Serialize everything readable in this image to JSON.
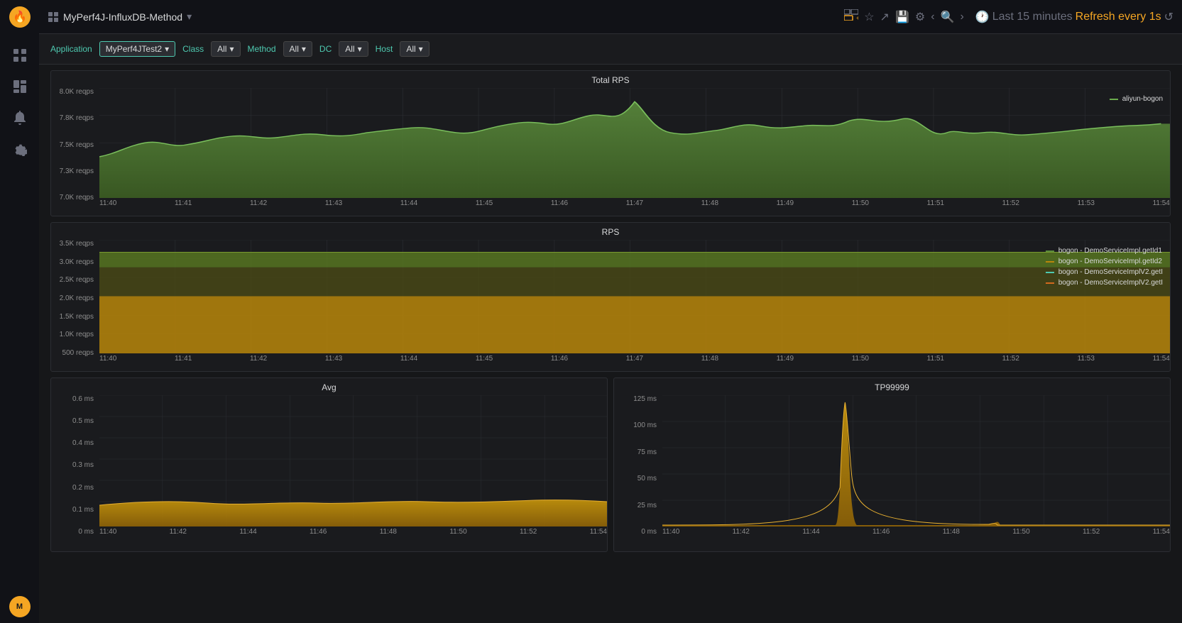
{
  "app": {
    "title": "MyPerf4J-InfluxDB-Method",
    "logo_icon": "🔥"
  },
  "topbar": {
    "title": "MyPerf4J-InfluxDB-Method",
    "dropdown_icon": "▾",
    "time_range": "Last 15 minutes",
    "refresh_label": "Refresh every 1s"
  },
  "sidebar": {
    "icons": [
      {
        "name": "grid-icon",
        "symbol": "⊞"
      },
      {
        "name": "layers-icon",
        "symbol": "◫"
      },
      {
        "name": "bell-icon",
        "symbol": "🔔"
      },
      {
        "name": "settings-icon",
        "symbol": "⚙"
      }
    ]
  },
  "filters": [
    {
      "label": "Application",
      "type": "label"
    },
    {
      "label": "MyPerf4JTest2",
      "type": "dropdown",
      "value": "MyPerf4JTest2"
    },
    {
      "label": "Class",
      "type": "label"
    },
    {
      "label": "All",
      "type": "dropdown",
      "value": "All"
    },
    {
      "label": "Method",
      "type": "label"
    },
    {
      "label": "All",
      "type": "dropdown",
      "value": "All"
    },
    {
      "label": "DC",
      "type": "label"
    },
    {
      "label": "All",
      "type": "dropdown",
      "value": "All"
    },
    {
      "label": "Host",
      "type": "label"
    },
    {
      "label": "All",
      "type": "dropdown",
      "value": "All"
    }
  ],
  "charts": {
    "total_rps": {
      "title": "Total RPS",
      "yaxis": [
        "8.0K reqps",
        "7.8K reqps",
        "7.5K reqps",
        "7.3K reqps",
        "7.0K reqps"
      ],
      "xaxis": [
        "11:40",
        "11:41",
        "11:42",
        "11:43",
        "11:44",
        "11:45",
        "11:46",
        "11:47",
        "11:48",
        "11:49",
        "11:50",
        "11:51",
        "11:52",
        "11:53",
        "11:54"
      ],
      "legend": [
        {
          "label": "aliyun-bogon",
          "color": "#5a8a3c"
        }
      ],
      "fill_color": "#4a7a32",
      "stroke_color": "#6aab4c"
    },
    "rps": {
      "title": "RPS",
      "yaxis": [
        "3.5K reqps",
        "3.0K reqps",
        "2.5K reqps",
        "2.0K reqps",
        "1.5K reqps",
        "1.0K reqps",
        "500 reqps"
      ],
      "xaxis": [
        "11:40",
        "11:41",
        "11:42",
        "11:43",
        "11:44",
        "11:45",
        "11:46",
        "11:47",
        "11:48",
        "11:49",
        "11:50",
        "11:51",
        "11:52",
        "11:53",
        "11:54"
      ],
      "legend": [
        {
          "label": "bogon - DemoServiceImpl.getId1",
          "color": "#5a8a3c"
        },
        {
          "label": "bogon - DemoServiceImpl.getId2",
          "color": "#b8860b"
        },
        {
          "label": "bogon - DemoServiceImplV2.getI",
          "color": "#4ec9b0"
        },
        {
          "label": "bogon - DemoServiceImplV2.getI",
          "color": "#d2691e"
        }
      ]
    },
    "avg": {
      "title": "Avg",
      "yaxis": [
        "0.6 ms",
        "0.5 ms",
        "0.4 ms",
        "0.3 ms",
        "0.2 ms",
        "0.1 ms",
        "0 ms"
      ],
      "xaxis": [
        "11:40",
        "11:42",
        "11:44",
        "11:46",
        "11:48",
        "11:50",
        "11:52",
        "11:54"
      ],
      "fill_color": "#b8860b",
      "stroke_color": "#d4a017"
    },
    "tp99999": {
      "title": "TP99999",
      "yaxis": [
        "125 ms",
        "100 ms",
        "75 ms",
        "50 ms",
        "25 ms",
        "0 ms"
      ],
      "xaxis": [
        "11:40",
        "11:42",
        "11:44",
        "11:46",
        "11:48",
        "11:50",
        "11:52",
        "11:54"
      ],
      "fill_color": "#b8860b",
      "stroke_color": "#d4a017"
    }
  }
}
